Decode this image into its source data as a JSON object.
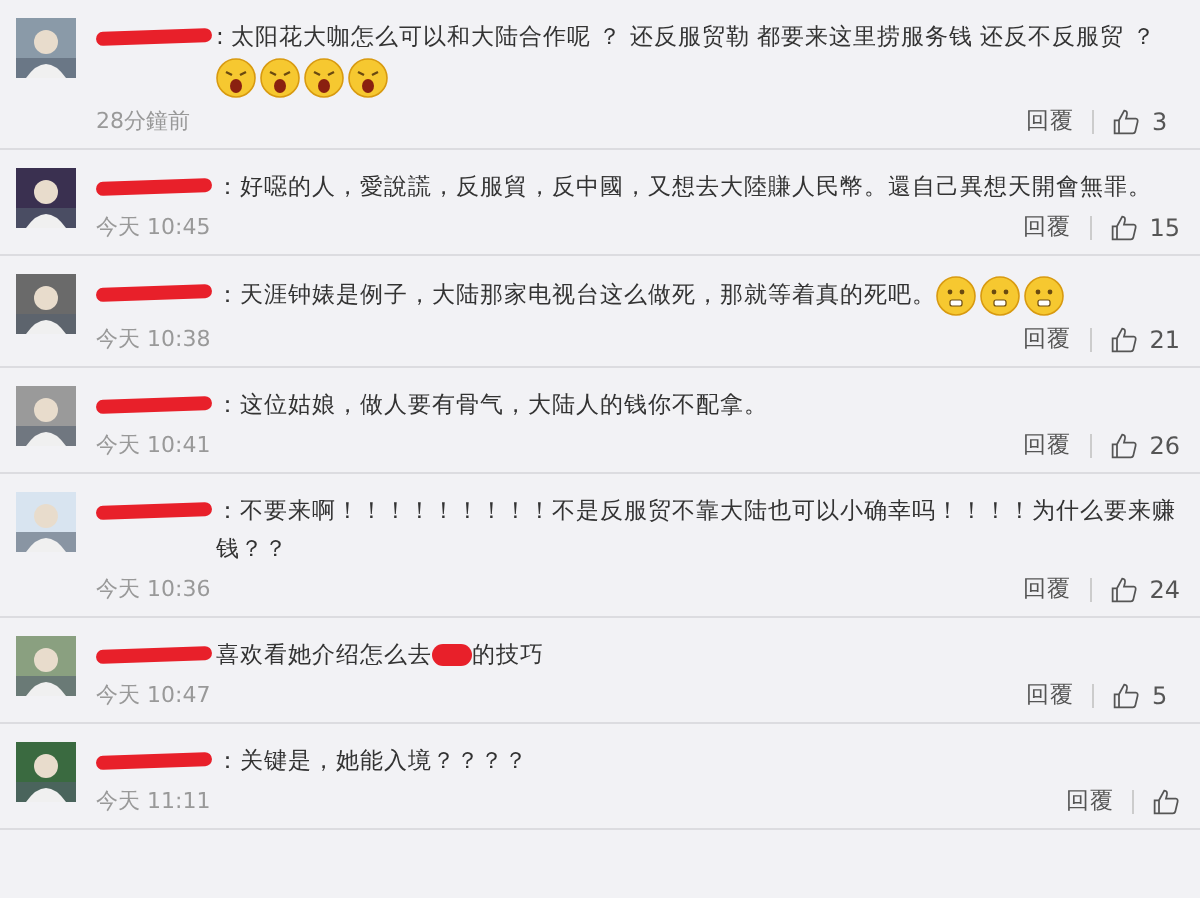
{
  "comments": [
    {
      "segments": [
        {
          "kind": "text",
          "text": ": 太阳花大咖怎么可以和大陆合作呢 ？ 还反服贸勒 都要来这里捞服务钱 还反不反服贸 ？"
        },
        {
          "kind": "break"
        },
        {
          "kind": "angry"
        },
        {
          "kind": "angry"
        },
        {
          "kind": "angry"
        },
        {
          "kind": "angry"
        }
      ],
      "time": "28分鐘前",
      "reply": "回覆",
      "likes": "3"
    },
    {
      "segments": [
        {
          "kind": "text",
          "text": "：好噁的人，愛說謊，反服貿，反中國，又想去大陸賺人民幣。還自己異想天開會無罪。"
        }
      ],
      "time": "今天 10:45",
      "reply": "回覆",
      "likes": "15"
    },
    {
      "segments": [
        {
          "kind": "text",
          "text": "：天涯钟婊是例子，大陆那家电视台这么做死，那就等着真的死吧。"
        },
        {
          "kind": "grin"
        },
        {
          "kind": "grin"
        },
        {
          "kind": "grin"
        }
      ],
      "time": "今天 10:38",
      "reply": "回覆",
      "likes": "21"
    },
    {
      "segments": [
        {
          "kind": "text",
          "text": "：这位姑娘，做人要有骨气，大陆人的钱你不配拿。"
        }
      ],
      "time": "今天 10:41",
      "reply": "回覆",
      "likes": "26"
    },
    {
      "segments": [
        {
          "kind": "text",
          "text": "：不要来啊！！！！！！！！！不是反服贸不靠大陆也可以小确幸吗！！！！为什么要来赚钱？？"
        }
      ],
      "time": "今天 10:36",
      "reply": "回覆",
      "likes": "24"
    },
    {
      "segments": [
        {
          "kind": "text",
          "text": "喜欢看她介绍怎么去"
        },
        {
          "kind": "redacted"
        },
        {
          "kind": "text",
          "text": "的技巧"
        }
      ],
      "time": "今天 10:47",
      "reply": "回覆",
      "likes": "5"
    },
    {
      "segments": [
        {
          "kind": "text",
          "text": "：关键是，她能入境？？？？"
        }
      ],
      "time": "今天 11:11",
      "reply": "回覆"
    }
  ]
}
